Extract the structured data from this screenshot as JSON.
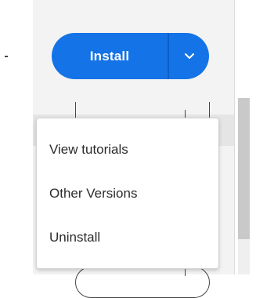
{
  "install_button": {
    "label": "Install",
    "color": "#1473e6",
    "dropdown_icon": "chevron-down-icon"
  },
  "dropdown_menu": {
    "items": [
      {
        "label": "View tutorials"
      },
      {
        "label": "Other Versions"
      },
      {
        "label": "Uninstall"
      }
    ]
  }
}
